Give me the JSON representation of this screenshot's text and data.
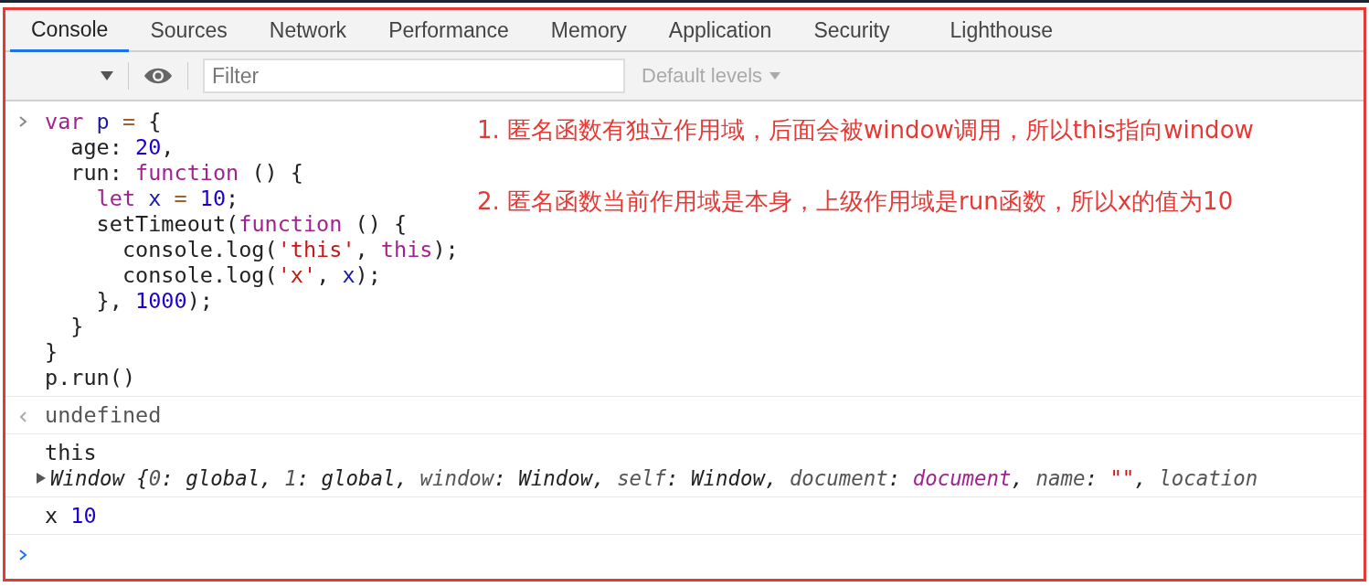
{
  "tabs": [
    {
      "label": "Console",
      "selected": true
    },
    {
      "label": "Sources",
      "selected": false
    },
    {
      "label": "Network",
      "selected": false
    },
    {
      "label": "Performance",
      "selected": false
    },
    {
      "label": "Memory",
      "selected": false
    },
    {
      "label": "Application",
      "selected": false
    },
    {
      "label": "Security",
      "selected": false
    },
    {
      "label": "Lighthouse",
      "selected": false
    }
  ],
  "toolbar": {
    "filter": {
      "placeholder": "Filter"
    },
    "levels": "Default levels"
  },
  "input": {
    "lines": [
      [
        {
          "text": "var ",
          "kind": "kw"
        },
        {
          "text": "p",
          "kind": "var"
        },
        {
          "text": " = ",
          "kind": "op"
        },
        {
          "text": "{",
          "kind": "plain"
        }
      ],
      [
        {
          "text": "  age: ",
          "kind": "plain"
        },
        {
          "text": "20",
          "kind": "num"
        },
        {
          "text": ",",
          "kind": "plain"
        }
      ],
      [
        {
          "text": "  run: ",
          "kind": "plain"
        },
        {
          "text": "function",
          "kind": "kw"
        },
        {
          "text": " () {",
          "kind": "plain"
        }
      ],
      [
        {
          "text": "    let",
          "kind": "kw"
        },
        {
          "text": " x",
          "kind": "var"
        },
        {
          "text": " = ",
          "kind": "op"
        },
        {
          "text": "10",
          "kind": "num"
        },
        {
          "text": ";",
          "kind": "plain"
        }
      ],
      [
        {
          "text": "    setTimeout(",
          "kind": "plain"
        },
        {
          "text": "function",
          "kind": "kw"
        },
        {
          "text": " () {",
          "kind": "plain"
        }
      ],
      [
        {
          "text": "      console.log(",
          "kind": "plain"
        },
        {
          "text": "'this'",
          "kind": "str"
        },
        {
          "text": ", ",
          "kind": "plain"
        },
        {
          "text": "this",
          "kind": "kw"
        },
        {
          "text": ");",
          "kind": "plain"
        }
      ],
      [
        {
          "text": "      console.log(",
          "kind": "plain"
        },
        {
          "text": "'x'",
          "kind": "str"
        },
        {
          "text": ", ",
          "kind": "plain"
        },
        {
          "text": "x",
          "kind": "var"
        },
        {
          "text": ");",
          "kind": "plain"
        }
      ],
      [
        {
          "text": "    }, ",
          "kind": "plain"
        },
        {
          "text": "1000",
          "kind": "num"
        },
        {
          "text": ");",
          "kind": "plain"
        }
      ],
      [
        {
          "text": "  }",
          "kind": "plain"
        }
      ],
      [
        {
          "text": "}",
          "kind": "plain"
        }
      ],
      [
        {
          "text": "p.run()",
          "kind": "plain"
        }
      ]
    ]
  },
  "result": "undefined",
  "logs": [
    {
      "lines": [
        {
          "tokens": [
            {
              "text": "this",
              "kind": "plain"
            }
          ]
        },
        {
          "expanded": false,
          "tokens": [
            {
              "text": "Window {",
              "kind": "plain"
            },
            {
              "text": "0",
              "kind": "key"
            },
            {
              "text": ": global, ",
              "kind": "plain"
            },
            {
              "text": "1",
              "kind": "key"
            },
            {
              "text": ": global, ",
              "kind": "plain"
            },
            {
              "text": "window",
              "kind": "key"
            },
            {
              "text": ": Window, ",
              "kind": "plain"
            },
            {
              "text": "self",
              "kind": "key"
            },
            {
              "text": ": Window, ",
              "kind": "plain"
            },
            {
              "text": "document",
              "kind": "key"
            },
            {
              "text": ": ",
              "kind": "plain"
            },
            {
              "text": "document",
              "kind": "kw"
            },
            {
              "text": ", ",
              "kind": "plain"
            },
            {
              "text": "name",
              "kind": "key"
            },
            {
              "text": ": ",
              "kind": "plain"
            },
            {
              "text": "\"\"",
              "kind": "str"
            },
            {
              "text": ", ",
              "kind": "plain"
            },
            {
              "text": "location",
              "kind": "key"
            }
          ]
        }
      ]
    },
    {
      "lines": [
        {
          "tokens": [
            {
              "text": "x ",
              "kind": "plain"
            },
            {
              "text": "10",
              "kind": "num"
            }
          ]
        }
      ]
    }
  ],
  "annotations": [
    "1. 匿名函数有独立作用域，后面会被window调用，所以this指向window",
    "2. 匿名函数当前作用域是本身，上级作用域是run函数，所以x的值为10"
  ]
}
